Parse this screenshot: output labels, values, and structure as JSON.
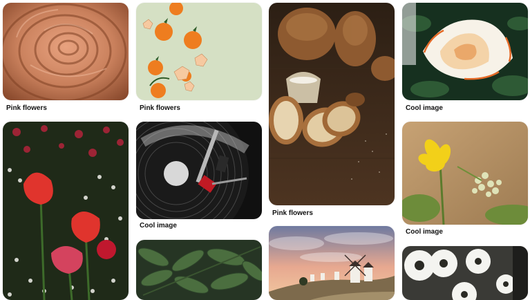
{
  "gallery": {
    "items": [
      {
        "title": "Pink flowers",
        "image": "pink-rose-macro"
      },
      {
        "title": "Pink flowers",
        "image": "oranges-on-green"
      },
      {
        "title": "Pink flowers",
        "image": "bread-loaves"
      },
      {
        "title": "Cool image",
        "image": "white-orange-rose"
      },
      {
        "title": "",
        "image": "red-tulips-field"
      },
      {
        "title": "Cool image",
        "image": "vinyl-turntable"
      },
      {
        "title": "Cool image",
        "image": "yellow-wildflower"
      },
      {
        "title": "",
        "image": "green-leaves"
      },
      {
        "title": "",
        "image": "windmills-sunset"
      },
      {
        "title": "",
        "image": "white-daisies"
      }
    ]
  },
  "colors": {
    "caption": "#111111",
    "background": "#ffffff"
  }
}
